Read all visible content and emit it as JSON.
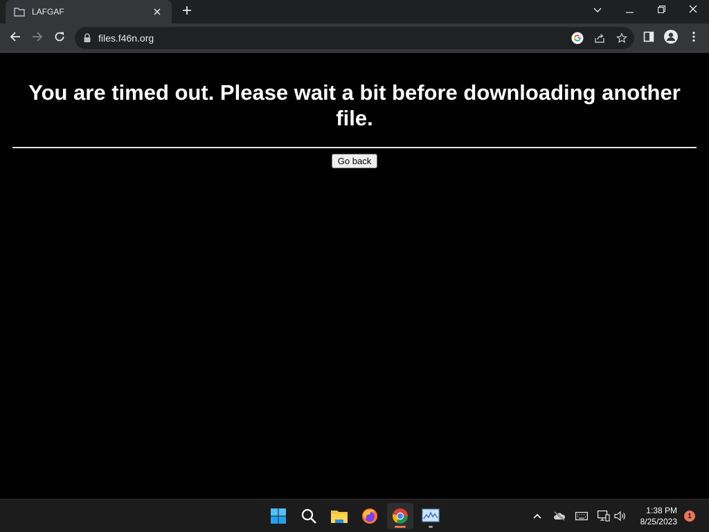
{
  "browser": {
    "tab": {
      "title": "LAFGAF",
      "favicon": "folder-icon"
    },
    "new_tab_icon": "plus-icon",
    "window_controls": [
      "tab-search-icon",
      "minimize-icon",
      "restore-icon",
      "close-icon"
    ],
    "toolbar": {
      "back_icon": "back-arrow-icon",
      "forward_icon": "forward-arrow-icon",
      "reload_icon": "reload-icon",
      "url": "files.f46n.org",
      "omnibox_icons": [
        "google-icon",
        "share-icon",
        "bookmark-star-icon"
      ],
      "right_icons": [
        "side-panel-icon",
        "profile-icon",
        "menu-icon"
      ]
    }
  },
  "page": {
    "heading": "You are timed out. Please wait a bit before downloading another file.",
    "button_label": "Go back",
    "background_color": "#000000",
    "text_color": "#ffffff"
  },
  "taskbar": {
    "apps": [
      {
        "name": "windows-start-icon",
        "active": false
      },
      {
        "name": "search-icon",
        "active": false
      },
      {
        "name": "file-explorer-icon",
        "active": false
      },
      {
        "name": "firefox-icon",
        "active": false
      },
      {
        "name": "chrome-icon",
        "active": true
      },
      {
        "name": "task-manager-icon",
        "active": false
      }
    ],
    "tray_icons": [
      "chevron-up-icon",
      "cloud-offline-icon",
      "keyboard-icon",
      "network-icon",
      "volume-icon"
    ],
    "time": "1:38 PM",
    "date": "8/25/2023",
    "notification_count": "1"
  }
}
